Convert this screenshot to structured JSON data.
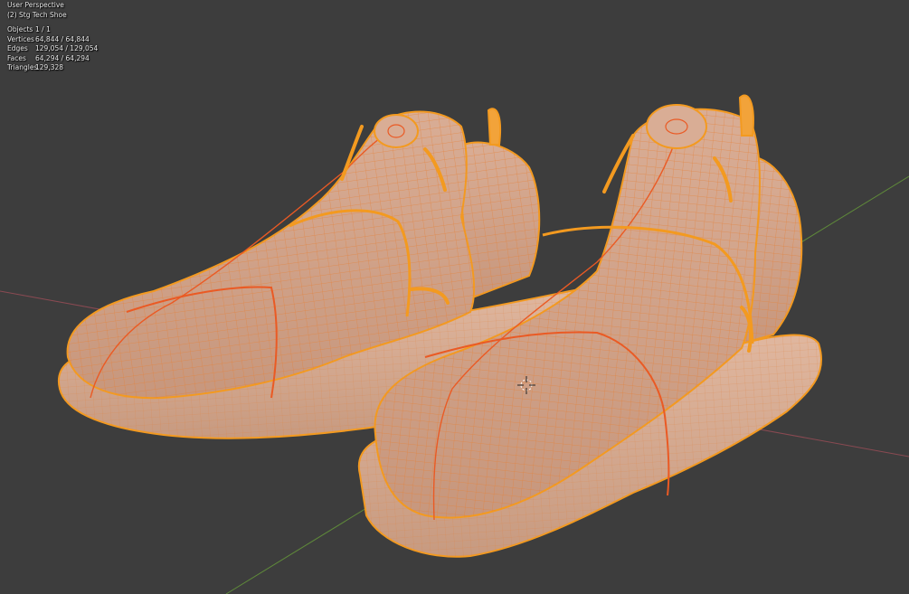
{
  "viewport": {
    "view_name": "User Perspective",
    "collection_label": "(2) Stg Tech Shoe",
    "stats": [
      {
        "label": "Objects",
        "value": "1 / 1"
      },
      {
        "label": "Vertices",
        "value": "64,844 / 64,844"
      },
      {
        "label": "Edges",
        "value": "129,054 / 129,054"
      },
      {
        "label": "Faces",
        "value": "64,294 / 64,294"
      },
      {
        "label": "Triangles",
        "value": "129,328"
      }
    ]
  },
  "colors": {
    "background": "#3d3d3d",
    "mesh_fill": "#d2a58c",
    "wire": "#e4813a",
    "seam": "#ea5a24",
    "selection_outline": "#f39a20",
    "x_axis": "#8a4a52",
    "y_axis": "#5f8a3a"
  },
  "icons": {
    "origin": "3d-cursor-icon"
  }
}
